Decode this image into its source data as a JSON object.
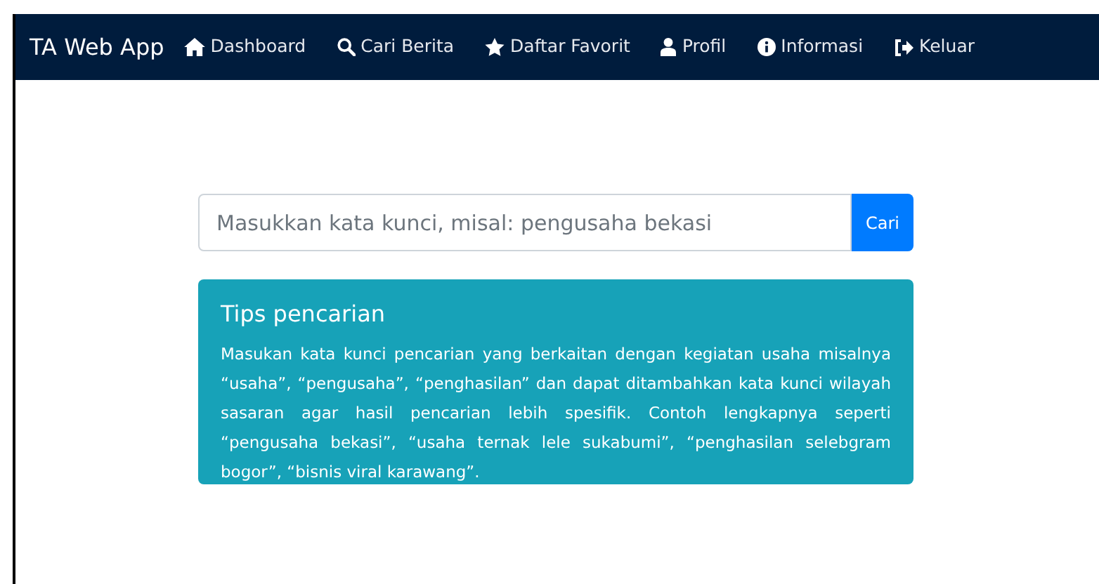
{
  "navbar": {
    "brand": "TA Web App",
    "items": [
      {
        "label": "Dashboard"
      },
      {
        "label": "Cari Berita"
      },
      {
        "label": "Daftar Favorit"
      },
      {
        "label": "Profil"
      },
      {
        "label": "Informasi"
      },
      {
        "label": "Keluar"
      }
    ]
  },
  "search": {
    "placeholder": "Masukkan kata kunci, misal: pengusaha bekasi",
    "button": "Cari"
  },
  "tips": {
    "title": "Tips pencarian",
    "text": "Masukan kata kunci pencarian yang berkaitan dengan kegiatan usaha misalnya “usaha”, “pengusaha”, “penghasilan” dan dapat ditambahkan kata kunci wilayah sasaran agar hasil pencarian lebih spesifik. Contoh lengkapnya seperti “pengusaha bekasi”, “usaha ternak lele sukabumi”, “penghasilan selebgram bogor”, “bisnis viral karawang”."
  }
}
